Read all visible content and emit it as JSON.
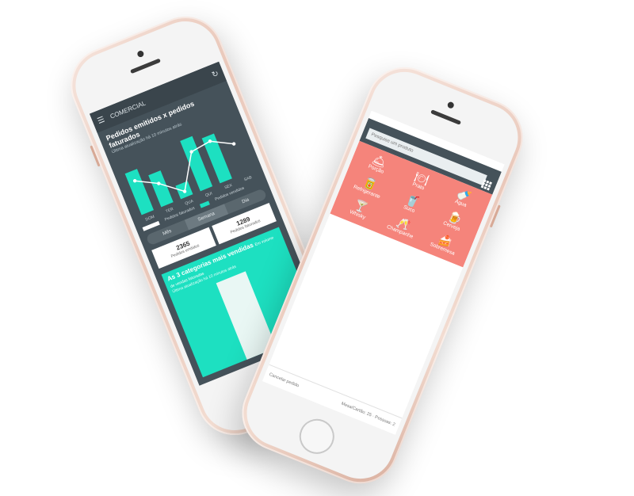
{
  "phone_left": {
    "topbar": {
      "title": "COMERCIAL",
      "menu_icon": "menu-icon",
      "refresh_icon": "refresh-icon"
    },
    "chart": {
      "title": "Pedidos emitidos x pedidos faturados",
      "subtitle": "Última atualização há 10 minutos atrás"
    },
    "chart_data": {
      "type": "bar",
      "categories": [
        "DOM",
        "TER",
        "QUA",
        "QUI",
        "SEX",
        "SAB"
      ],
      "series": [
        {
          "name": "Pedidos faturados",
          "values": [
            78,
            60,
            25,
            95,
            85,
            0
          ]
        },
        {
          "name": "Pedidos vendidos",
          "values": [
            60,
            40,
            10,
            70,
            75,
            55
          ]
        }
      ],
      "colors": {
        "bars": "#1de0c1",
        "line": "#ffffff"
      }
    },
    "legend": {
      "faturados": "Pedidos faturados",
      "vendidos": "Pedidos vendidos"
    },
    "segments": {
      "mes": "Mês",
      "semana": "Semana",
      "dia": "Dia"
    },
    "stats": {
      "emitidos_value": "2365",
      "emitidos_label": "Pedidos emitidos",
      "faturados_value": "1289",
      "faturados_label": "Pedidos faturados"
    },
    "categories_card": {
      "title": "As 3 categorias mais vendidas",
      "title_suffix": "Em volume de vendas faturadas",
      "subtitle": "Última atualização há 10 minutos atrás"
    }
  },
  "phone_right": {
    "search": {
      "placeholder": "Pesquise um produto"
    },
    "categories": [
      {
        "label": "Porção",
        "icon": "cloche-icon",
        "glyph": "🛎"
      },
      {
        "label": "Prato",
        "icon": "plate-icon",
        "glyph": "🍽"
      },
      {
        "label": "Água",
        "icon": "bottle-icon",
        "glyph": "🍼"
      },
      {
        "label": "Refrigerante",
        "icon": "can-icon",
        "glyph": "🥫"
      },
      {
        "label": "Suco",
        "icon": "juice-icon",
        "glyph": "🥤"
      },
      {
        "label": "Cerveja",
        "icon": "beer-icon",
        "glyph": "🍺"
      },
      {
        "label": "Whisky",
        "icon": "cocktail-icon",
        "glyph": "🍸"
      },
      {
        "label": "Champanhe",
        "icon": "champagne-icon",
        "glyph": "🥂"
      },
      {
        "label": "Sobremesa",
        "icon": "dessert-icon",
        "glyph": "🍰"
      }
    ],
    "footer": {
      "cancel": "Cancelar pedido",
      "info": "Mesa/Cartão: 25 · Pessoas: 2"
    },
    "colors": {
      "accent": "#f5847b",
      "bar": "#45525a"
    }
  }
}
